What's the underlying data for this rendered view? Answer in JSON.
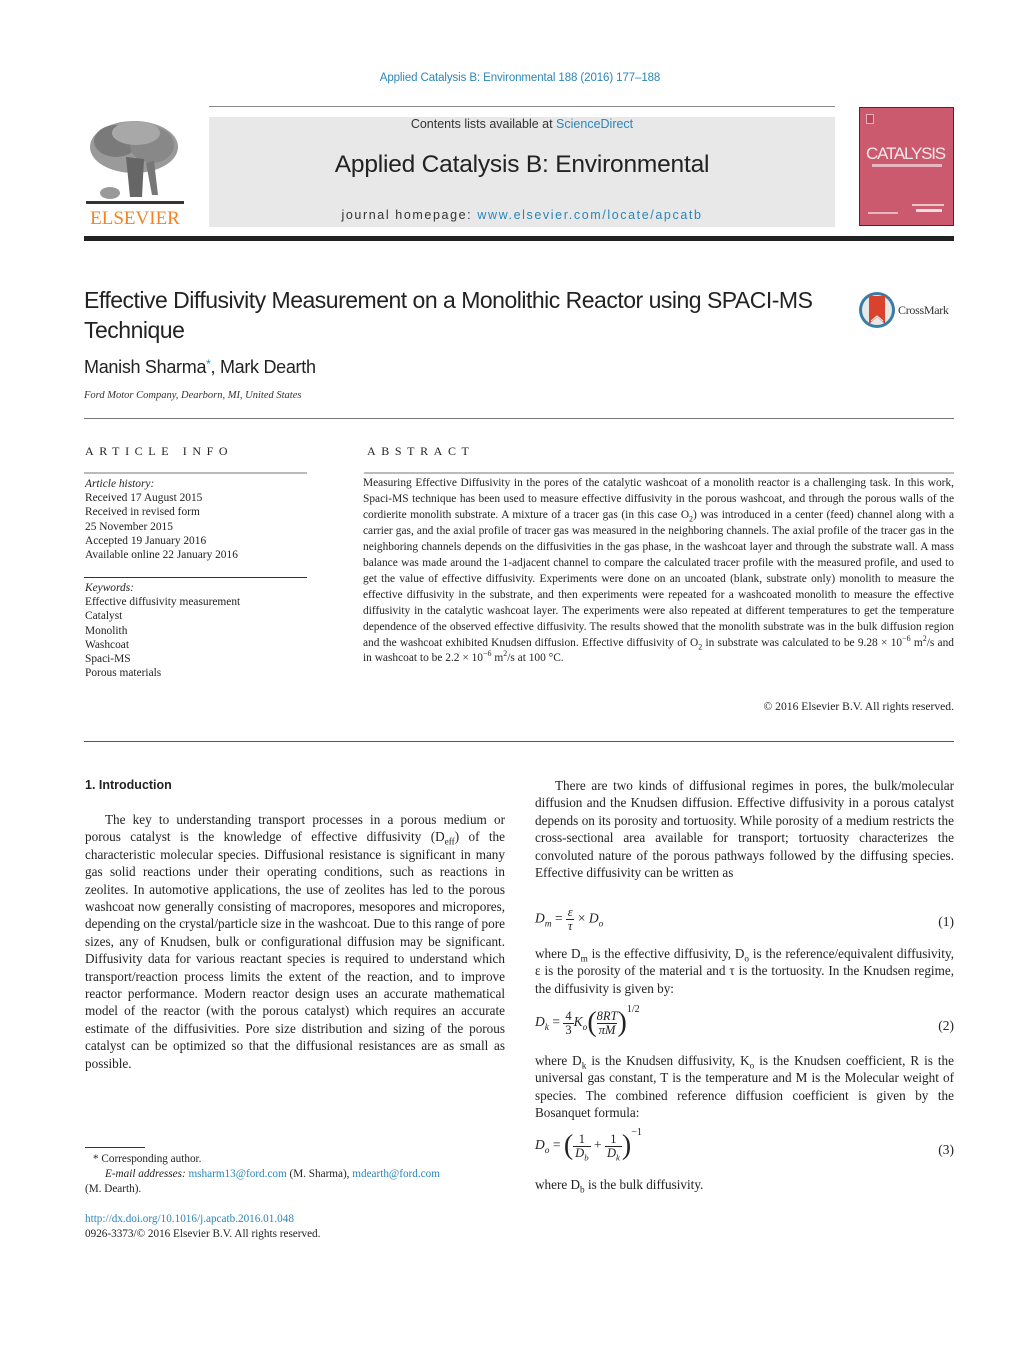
{
  "header": {
    "journal_reference": "Applied Catalysis B: Environmental 188 (2016) 177–188",
    "contents_prefix": "Contents lists available at ",
    "contents_link": "ScienceDirect",
    "journal_name": "Applied Catalysis B: Environmental",
    "homepage_prefix": "journal homepage: ",
    "homepage_link": "www.elsevier.com/locate/apcatb",
    "publisher_logo_text": "ELSEVIER",
    "cover_title": "CATALYSIS",
    "crossmark_label": "CrossMark"
  },
  "article": {
    "title": "Effective Diffusivity Measurement on a Monolithic Reactor using SPACI-MS Technique",
    "authors": [
      {
        "name": "Manish Sharma",
        "corresponding": true
      },
      {
        "name": "Mark Dearth",
        "corresponding": false
      }
    ],
    "author_separator": ", ",
    "corresponding_mark": "*",
    "affiliation": "Ford Motor Company, Dearborn, MI, United States"
  },
  "article_info": {
    "heading": "ARTICLE INFO",
    "history_label": "Article history:",
    "history": [
      "Received 17 August 2015",
      "Received in revised form",
      "25 November 2015",
      "Accepted 19 January 2016",
      "Available online 22 January 2016"
    ],
    "keywords_label": "Keywords:",
    "keywords": [
      "Effective diffusivity measurement",
      "Catalyst",
      "Monolith",
      "Washcoat",
      "Spaci-MS",
      "Porous materials"
    ]
  },
  "abstract": {
    "heading": "ABSTRACT",
    "text_1": "Measuring Effective Diffusivity in the pores of the catalytic washcoat of a monolith reactor is a challenging task. In this work, Spaci-MS technique has been used to measure effective diffusivity in the porous washcoat, and through the porous walls of the cordierite monolith substrate. A mixture of a tracer gas (in this case O",
    "sub_1": "2",
    "text_2": ") was introduced in a center (feed) channel along with a carrier gas, and the axial profile of tracer gas was measured in the neighboring channels. The axial profile of the tracer gas in the neighboring channels depends on the diffusivities in the gas phase, in the washcoat layer and through the substrate wall. A mass balance was made around the 1-adjacent channel to compare the calculated tracer profile with the measured profile, and used to get the value of effective diffusivity. Experiments were done on an uncoated (blank, substrate only) monolith to measure the effective diffusivity in the substrate, and then experiments were repeated for a washcoated monolith to measure the effective diffusivity in the catalytic washcoat layer. The experiments were also repeated at different temperatures to get the temperature dependence of the observed effective diffusivity. The results showed that the monolith substrate was in the bulk diffusion region and the washcoat exhibited Knudsen diffusion. Effective diffusivity of O",
    "sub_2": "2",
    "text_3": " in substrate was calculated to be 9.28 × 10",
    "sup_1": "−6",
    "text_4": " m",
    "sup_2": "2",
    "text_5": "/s and in washcoat to be 2.2 × 10",
    "sup_3": "−6",
    "text_6": " m",
    "sup_4": "2",
    "text_7": "/s at 100 °C.",
    "copyright": "© 2016 Elsevier B.V. All rights reserved."
  },
  "introduction": {
    "heading": "1.  Introduction",
    "p1_a": "The key to understanding transport processes in a porous medium or porous catalyst is the knowledge of effective diffusivity (D",
    "p1_sub": "eff",
    "p1_b": ") of the characteristic molecular species. Diffusional resistance is significant in many gas solid reactions under their operating conditions, such as reactions in zeolites. In automotive applications, the use of zeolites has led to the porous washcoat now generally consisting of macropores, mesopores and micropores, depending on the crystal/particle size in the washcoat. Due to this range of pore sizes, any of Knudsen, bulk or configurational diffusion may be significant. Diffusivity data for various reactant species is required to understand which transport/reaction process limits the extent of the reaction, and to improve reactor performance. Modern reactor design uses an accurate mathematical model of the reactor (with the porous catalyst) which requires an accurate estimate of the diffusivities. Pore size distribution and sizing of the porous catalyst can be optimized so that the diffusional resistances are as small as possible.",
    "p2": "There are two kinds of diffusional regimes in pores, the bulk/molecular diffusion and the Knudsen diffusion. Effective diffusivity in a porous catalyst depends on its porosity and tortuosity. While porosity of a medium restricts the cross-sectional area available for transport; tortuosity characterizes the convoluted nature of the porous pathways followed by the diffusing species. Effective diffusivity can be written as",
    "eq1": {
      "lhs": "D",
      "lhs_sub": "m",
      "num": "ε",
      "den": "τ",
      "times": "×",
      "rhs": "D",
      "rhs_sub": "o",
      "number": "(1)"
    },
    "p3": {
      "a": "where D",
      "a_sub": "m",
      "b": " is the effective diffusivity, D",
      "b_sub": "o",
      "c": " is the reference/equivalent diffusivity, ε is the porosity of the material and τ is the tortuosity. In the Knudsen regime, the diffusivity is given by:"
    },
    "eq2": {
      "lhs": "D",
      "lhs_sub": "k",
      "coef_num": "4",
      "coef_den": "3",
      "k": "K",
      "k_sub": "o",
      "frac_num": "8RT",
      "frac_den": "πM",
      "power": "1/2",
      "number": "(2)"
    },
    "p4": {
      "a": "where D",
      "a_sub": "k",
      "b": " is the Knudsen diffusivity, K",
      "b_sub": "o",
      "c": " is the Knudsen coefficient, R is the universal gas constant, T is the temperature and M is the Molecular weight of species. The combined reference diffusion coefficient is given by the Bosanquet formula:"
    },
    "eq3": {
      "lhs": "D",
      "lhs_sub": "o",
      "n1": "1",
      "d1": "D",
      "d1_sub": "b",
      "plus": "+",
      "n2": "1",
      "d2": "D",
      "d2_sub": "k",
      "power": "−1",
      "number": "(3)"
    },
    "p5": {
      "a": "where D",
      "a_sub": "b",
      "b": " is the bulk diffusivity."
    }
  },
  "footnote": {
    "corresponding": "* Corresponding author.",
    "email_label": "E-mail addresses: ",
    "email_1": "msharm13@ford.com",
    "email_1_name": " (M. Sharma), ",
    "email_2": "mdearth@ford.com",
    "email_2_name": "(M. Dearth).",
    "doi": "http://dx.doi.org/10.1016/j.apcatb.2016.01.048",
    "issn": "0926-3373/© 2016 Elsevier B.V. All rights reserved."
  },
  "colors": {
    "link": "#2a86b8",
    "elsevier_orange": "#f58220",
    "cover": "#cb5a6e",
    "header_box": "#e8e8e8"
  }
}
